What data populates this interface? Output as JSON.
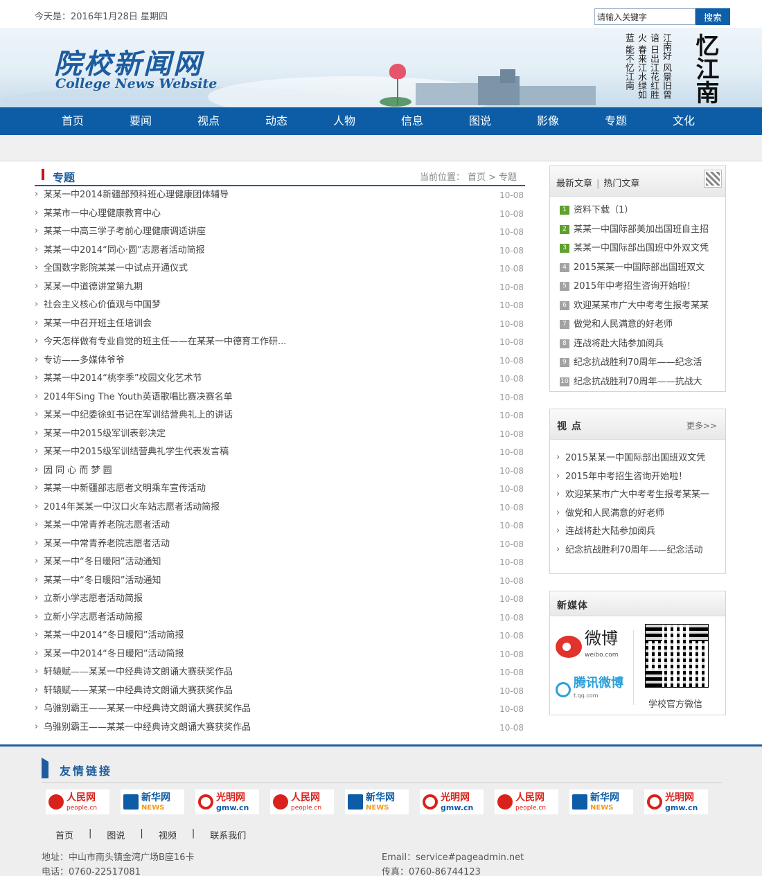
{
  "header": {
    "date_prefix": "今天是：",
    "date": "2016年1月28日 星期四",
    "search_placeholder": "请输入关键字",
    "search_button": "搜索",
    "site_title": "院校新闻网",
    "site_title_en": "College News Website",
    "poem": "江南好 风景旧曾谙 日出江花红胜火 春来江水绿如蓝 能不忆江南",
    "calligraphy": "忆江南"
  },
  "nav": [
    "首页",
    "要闻",
    "视点",
    "动态",
    "人物",
    "信息",
    "图说",
    "影像",
    "专题",
    "文化"
  ],
  "section": {
    "title": "专题",
    "breadcrumb_label": "当前位置：",
    "breadcrumb_home": "首页",
    "breadcrumb_sep": ">",
    "breadcrumb_current": "专题"
  },
  "articles": [
    {
      "title": "某某一中2014新疆部预科班心理健康团体辅导",
      "date": "10-08"
    },
    {
      "title": "某某市一中心理健康教育中心",
      "date": "10-08"
    },
    {
      "title": "某某一中高三学子考前心理健康调适讲座",
      "date": "10-08"
    },
    {
      "title": "某某一中2014“同心·圆”志愿者活动简报",
      "date": "10-08"
    },
    {
      "title": "全国数字影院某某一中试点开通仪式",
      "date": "10-08"
    },
    {
      "title": "某某一中道德讲堂第九期",
      "date": "10-08"
    },
    {
      "title": "社会主义核心价值观与中国梦",
      "date": "10-08"
    },
    {
      "title": "某某一中召开班主任培训会",
      "date": "10-08"
    },
    {
      "title": "今天怎样做有专业自觉的班主任——在某某一中德育工作研...",
      "date": "10-08"
    },
    {
      "title": "专访——多媒体爷爷",
      "date": "10-08"
    },
    {
      "title": "某某一中2014“桃李季”校园文化艺术节",
      "date": "10-08"
    },
    {
      "title": "2014年Sing The Youth英语歌唱比赛决赛名单",
      "date": "10-08"
    },
    {
      "title": "某某一中纪委徐虹书记在军训结营典礼上的讲话",
      "date": "10-08"
    },
    {
      "title": "某某一中2015级军训表彰决定",
      "date": "10-08"
    },
    {
      "title": "某某一中2015级军训结营典礼学生代表发言稿",
      "date": "10-08"
    },
    {
      "title": "因 同 心 而 梦 圆",
      "date": "10-08"
    },
    {
      "title": "某某一中新疆部志愿者文明乘车宣传活动",
      "date": "10-08"
    },
    {
      "title": "2014年某某一中汉口火车站志愿者活动简报",
      "date": "10-08"
    },
    {
      "title": "某某一中常青养老院志愿者活动",
      "date": "10-08"
    },
    {
      "title": "某某一中常青养老院志愿者活动",
      "date": "10-08"
    },
    {
      "title": "某某一中“冬日暖阳”活动通知",
      "date": "10-08"
    },
    {
      "title": "某某一中“冬日暖阳”活动通知",
      "date": "10-08"
    },
    {
      "title": "立新小学志愿者活动简报",
      "date": "10-08"
    },
    {
      "title": "立新小学志愿者活动简报",
      "date": "10-08"
    },
    {
      "title": "某某一中2014“冬日暖阳”活动简报",
      "date": "10-08"
    },
    {
      "title": "某某一中2014“冬日暖阳”活动简报",
      "date": "10-08"
    },
    {
      "title": "轩辕赋——某某一中经典诗文朗诵大赛获奖作品",
      "date": "10-08"
    },
    {
      "title": "轩辕赋——某某一中经典诗文朗诵大赛获奖作品",
      "date": "10-08"
    },
    {
      "title": "乌骓别霸王——某某一中经典诗文朗诵大赛获奖作品",
      "date": "10-08"
    },
    {
      "title": "乌骓别霸王——某某一中经典诗文朗诵大赛获奖作品",
      "date": "10-08"
    }
  ],
  "hot": {
    "tab_latest": "最新文章",
    "tab_sep": "|",
    "tab_hot": "热门文章",
    "items": [
      {
        "n": "1",
        "title": "资料下载（1）"
      },
      {
        "n": "2",
        "title": "某某一中国际部美加出国班自主招"
      },
      {
        "n": "3",
        "title": "某某一中国际部出国班中外双文凭"
      },
      {
        "n": "4",
        "title": "2015某某一中国际部出国班双文"
      },
      {
        "n": "5",
        "title": "2015年中考招生咨询开始啦！"
      },
      {
        "n": "6",
        "title": "欢迎某某市广大中考考生报考某某"
      },
      {
        "n": "7",
        "title": "做党和人民满意的好老师"
      },
      {
        "n": "8",
        "title": "连战将赴大陆参加阅兵"
      },
      {
        "n": "9",
        "title": "纪念抗战胜利70周年——纪念活"
      },
      {
        "n": "10",
        "title": "纪念抗战胜利70周年——抗战大"
      }
    ]
  },
  "viewpoint": {
    "title": "视 点",
    "more": "更多>>",
    "items": [
      "2015某某一中国际部出国班双文凭",
      "2015年中考招生咨询开始啦！",
      "欢迎某某市广大中考考生报考某某一",
      "做党和人民满意的好老师",
      "连战将赴大陆参加阅兵",
      "纪念抗战胜利70周年——纪念活动"
    ]
  },
  "newmedia": {
    "title": "新媒体",
    "weibo": "微博",
    "weibo_domain": "weibo.com",
    "qq": "腾讯微博",
    "qq_domain": "t.qq.com",
    "wechat_label": "学校官方微信"
  },
  "footer": {
    "links_title": "友情链接",
    "logos": [
      {
        "kind": "r",
        "name": "人民网",
        "domain": "people.cn"
      },
      {
        "kind": "x",
        "name": "新华网",
        "domain": "NEWS"
      },
      {
        "kind": "g",
        "name": "光明网",
        "domain": "gmw.cn"
      },
      {
        "kind": "r",
        "name": "人民网",
        "domain": "people.cn"
      },
      {
        "kind": "x",
        "name": "新华网",
        "domain": "NEWS"
      },
      {
        "kind": "g",
        "name": "光明网",
        "domain": "gmw.cn"
      },
      {
        "kind": "r",
        "name": "人民网",
        "domain": "people.cn"
      },
      {
        "kind": "x",
        "name": "新华网",
        "domain": "NEWS"
      },
      {
        "kind": "g",
        "name": "光明网",
        "domain": "gmw.cn"
      }
    ],
    "nav": [
      "首页",
      "图说",
      "视频",
      "联系我们"
    ],
    "nav_sep": "|",
    "address": "地址：中山市南头镇金湾广场B座16卡",
    "phone": "电话：0760-22517081",
    "email": "Email：service#pageadmin.net",
    "fax": "传真：0760-86744123"
  }
}
